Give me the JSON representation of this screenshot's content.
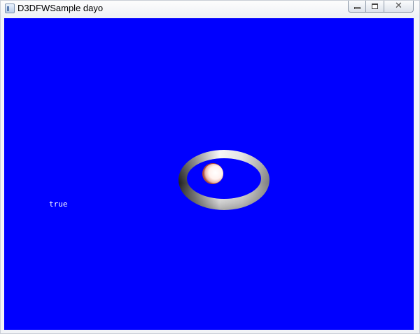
{
  "window": {
    "title": "D3DFWSample dayo",
    "icon": "application-window-icon"
  },
  "caption_buttons": {
    "minimize_icon": "minimize-icon",
    "maximize_icon": "maximize-icon",
    "close_icon": "close-icon",
    "close_glyph": "✕"
  },
  "scene": {
    "background_color": "#0000ff",
    "status_text": "true"
  }
}
